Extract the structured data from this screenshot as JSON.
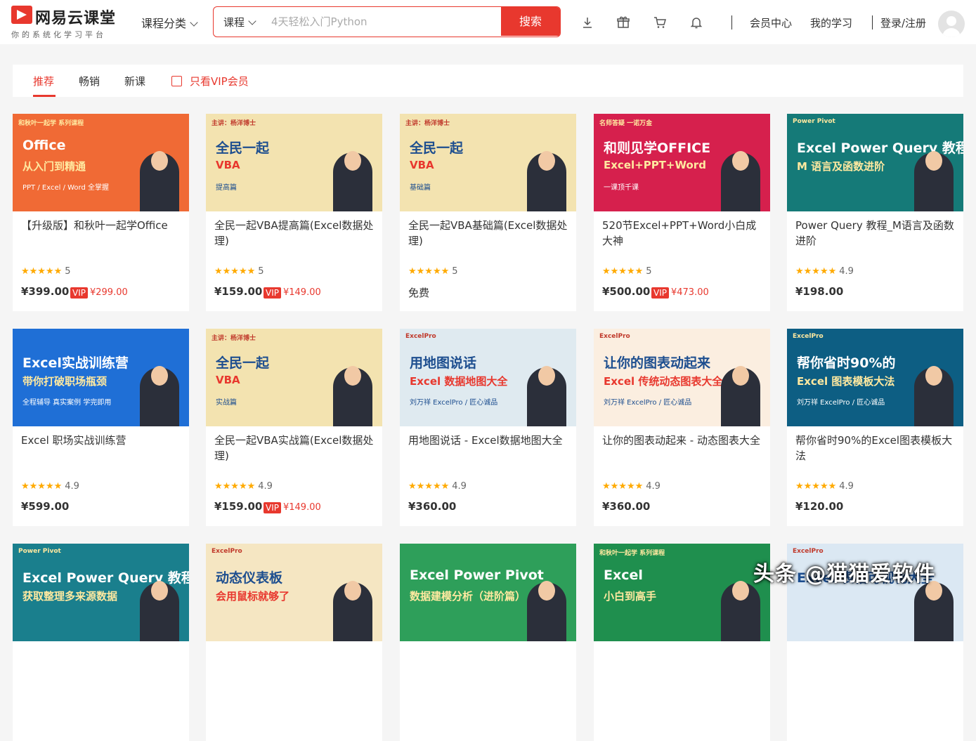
{
  "header": {
    "logo_name": "网易云课堂",
    "slogan": "你的系统化学习平台",
    "category_label": "课程分类",
    "search_type": "课程",
    "search_placeholder": "4天轻松入门Python",
    "search_button": "搜索",
    "member_center": "会员中心",
    "my_learning": "我的学习",
    "login": "登录/注册"
  },
  "tabs": {
    "recommend": "推荐",
    "bestseller": "畅销",
    "new": "新课",
    "vip_only": "只看VIP会员"
  },
  "courses": [
    {
      "title": "【升级版】和秋叶一起学Office",
      "rating": "5",
      "price": "¥399.00",
      "vip_label": "VIP",
      "vip_price": "¥299.00",
      "banner": {
        "line1": "Office",
        "line2": "从入门到精通",
        "line3": "PPT / Excel / Word 全掌握",
        "tag": "和秋叶一起学 系列课程",
        "bg": "#f06a35"
      }
    },
    {
      "title": "全民一起VBA提高篇(Excel数据处理)",
      "rating": "5",
      "price": "¥159.00",
      "vip_label": "VIP",
      "vip_price": "¥149.00",
      "banner": {
        "line1": "全民一起",
        "line2": "VBA",
        "line3": "提高篇",
        "tag": "主讲：杨洋博士",
        "bg": "#f3e3b0"
      }
    },
    {
      "title": "全民一起VBA基础篇(Excel数据处理)",
      "rating": "5",
      "price": "免费",
      "banner": {
        "line1": "全民一起",
        "line2": "VBA",
        "line3": "基础篇",
        "tag": "主讲：杨洋博士",
        "bg": "#f3e3b0"
      }
    },
    {
      "title": "520节Excel+PPT+Word小白成大神",
      "rating": "5",
      "price": "¥500.00",
      "vip_label": "VIP",
      "vip_price": "¥473.00",
      "banner": {
        "line1": "和则见学OFFICE",
        "line2": "Excel+PPT+Word",
        "line3": "一课顶千课",
        "tag": "名师答疑 一诺万金",
        "bg": "#d6204d"
      }
    },
    {
      "title": "Power Query 教程_M语言及函数进阶",
      "rating": "4.9",
      "price": "¥198.00",
      "banner": {
        "line1": "Excel Power Query 教程",
        "line2": "M 语言及函数进阶",
        "line3": "",
        "tag": "Power Pivot",
        "bg": "#157a78"
      }
    },
    {
      "title": "Excel 职场实战训练营",
      "rating": "4.9",
      "price": "¥599.00",
      "banner": {
        "line1": "Excel实战训练营",
        "line2": "带你打破职场瓶颈",
        "line3": "全程辅导 真实案例 学完即用",
        "tag": "",
        "bg": "#1f6fd6"
      }
    },
    {
      "title": "全民一起VBA实战篇(Excel数据处理)",
      "rating": "4.9",
      "price": "¥159.00",
      "vip_label": "VIP",
      "vip_price": "¥149.00",
      "banner": {
        "line1": "全民一起",
        "line2": "VBA",
        "line3": "实战篇",
        "tag": "主讲：杨洋博士",
        "bg": "#f3e3b0"
      }
    },
    {
      "title": "用地图说话 - Excel数据地图大全",
      "rating": "4.9",
      "price": "¥360.00",
      "banner": {
        "line1": "用地图说话",
        "line2": "Excel 数据地图大全",
        "line3": "刘万祥 ExcelPro / 匠心诚品",
        "tag": "ExcelPro",
        "bg": "#dfeaf0"
      }
    },
    {
      "title": "让你的图表动起来 - 动态图表大全",
      "rating": "4.9",
      "price": "¥360.00",
      "banner": {
        "line1": "让你的图表动起来",
        "line2": "Excel 传统动态图表大全",
        "line3": "刘万祥 ExcelPro / 匠心诚品",
        "tag": "ExcelPro",
        "bg": "#fbeee0"
      }
    },
    {
      "title": "帮你省时90%的Excel图表模板大法",
      "rating": "4.9",
      "price": "¥120.00",
      "banner": {
        "line1": "帮你省时90%的",
        "line2": "Excel 图表模板大法",
        "line3": "刘万祥 ExcelPro / 匠心诚品",
        "tag": "ExcelPro",
        "bg": "#0d5e83"
      }
    },
    {
      "title": "",
      "rating": "",
      "price": "",
      "banner": {
        "line1": "Excel Power Query 教程",
        "line2": "获取整理多来源数据",
        "line3": "",
        "tag": "Power Pivot",
        "bg": "#1a7f8d"
      }
    },
    {
      "title": "",
      "rating": "",
      "price": "",
      "banner": {
        "line1": "动态仪表板",
        "line2": "会用鼠标就够了",
        "line3": "",
        "tag": "ExcelPro",
        "bg": "#f5e6c2"
      }
    },
    {
      "title": "",
      "rating": "",
      "price": "",
      "banner": {
        "line1": "Excel Power Pivot",
        "line2": "数据建模分析（进阶篇）",
        "line3": "",
        "tag": "",
        "bg": "#2e9f5a"
      }
    },
    {
      "title": "",
      "rating": "",
      "price": "",
      "banner": {
        "line1": "Excel",
        "line2": "小白到高手",
        "line3": "",
        "tag": "和秋叶一起学 系列课程",
        "bg": "#1f8f4e"
      }
    },
    {
      "title": "",
      "rating": "",
      "price": "",
      "banner": {
        "line1": "Excel 表格可视化大全",
        "line2": "",
        "line3": "",
        "tag": "ExcelPro",
        "bg": "#dbe8f3"
      }
    }
  ],
  "watermark": "头条 @猫猫爱软件",
  "colors": {
    "accent": "#e8382e",
    "star": "#ffaa00"
  }
}
